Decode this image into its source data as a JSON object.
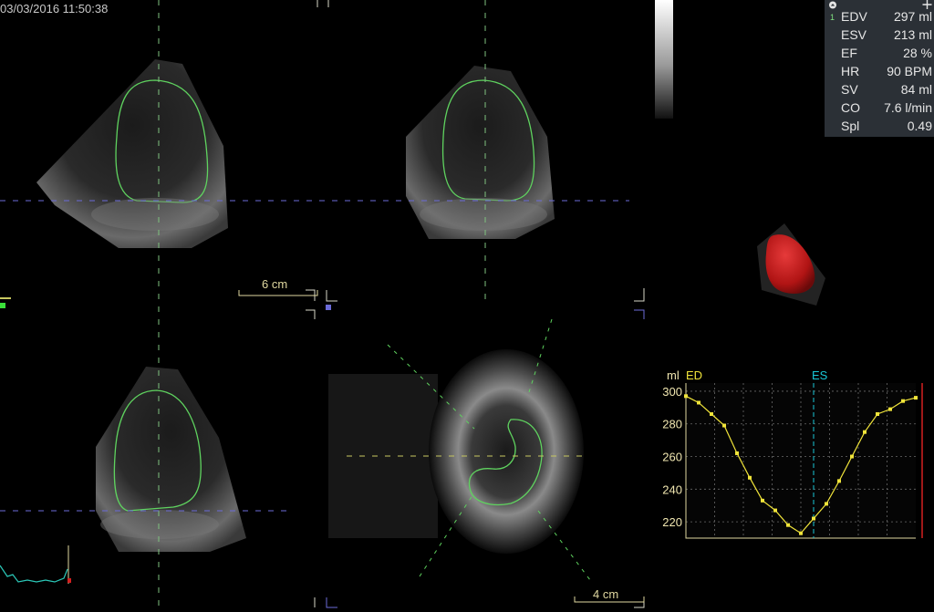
{
  "header": {
    "timestamp": "03/03/2016 11:50:38"
  },
  "measurements": [
    {
      "label": "EDV",
      "value": "297 ml",
      "marker": "1"
    },
    {
      "label": "ESV",
      "value": "213 ml"
    },
    {
      "label": "EF",
      "value": "28 %"
    },
    {
      "label": "HR",
      "value": "90 BPM"
    },
    {
      "label": "SV",
      "value": "84 ml"
    },
    {
      "label": "CO",
      "value": "7.6 l/min"
    },
    {
      "label": "Spl",
      "value": "0.49"
    }
  ],
  "scales": {
    "top_left": "6 cm",
    "bottom_right": "4 cm"
  },
  "colors": {
    "contour": "#5fd35f",
    "graph": "#f0e43a",
    "es_line": "#19c6d6",
    "current_frame": "#d42020",
    "heart_model": "#c41818"
  },
  "chart_data": {
    "type": "line",
    "ylabel": "ml",
    "ylim": [
      210,
      305
    ],
    "yticks": [
      220,
      240,
      260,
      280,
      300
    ],
    "markers": [
      {
        "label": "ED",
        "frame": 0
      },
      {
        "label": "ES",
        "frame": 10
      }
    ],
    "current_frame": 18.5,
    "series": [
      {
        "values": [
          297,
          293,
          286,
          279,
          262,
          247,
          233,
          227,
          218,
          213,
          222,
          231,
          245,
          260,
          275,
          286,
          289,
          294,
          296
        ]
      }
    ]
  }
}
